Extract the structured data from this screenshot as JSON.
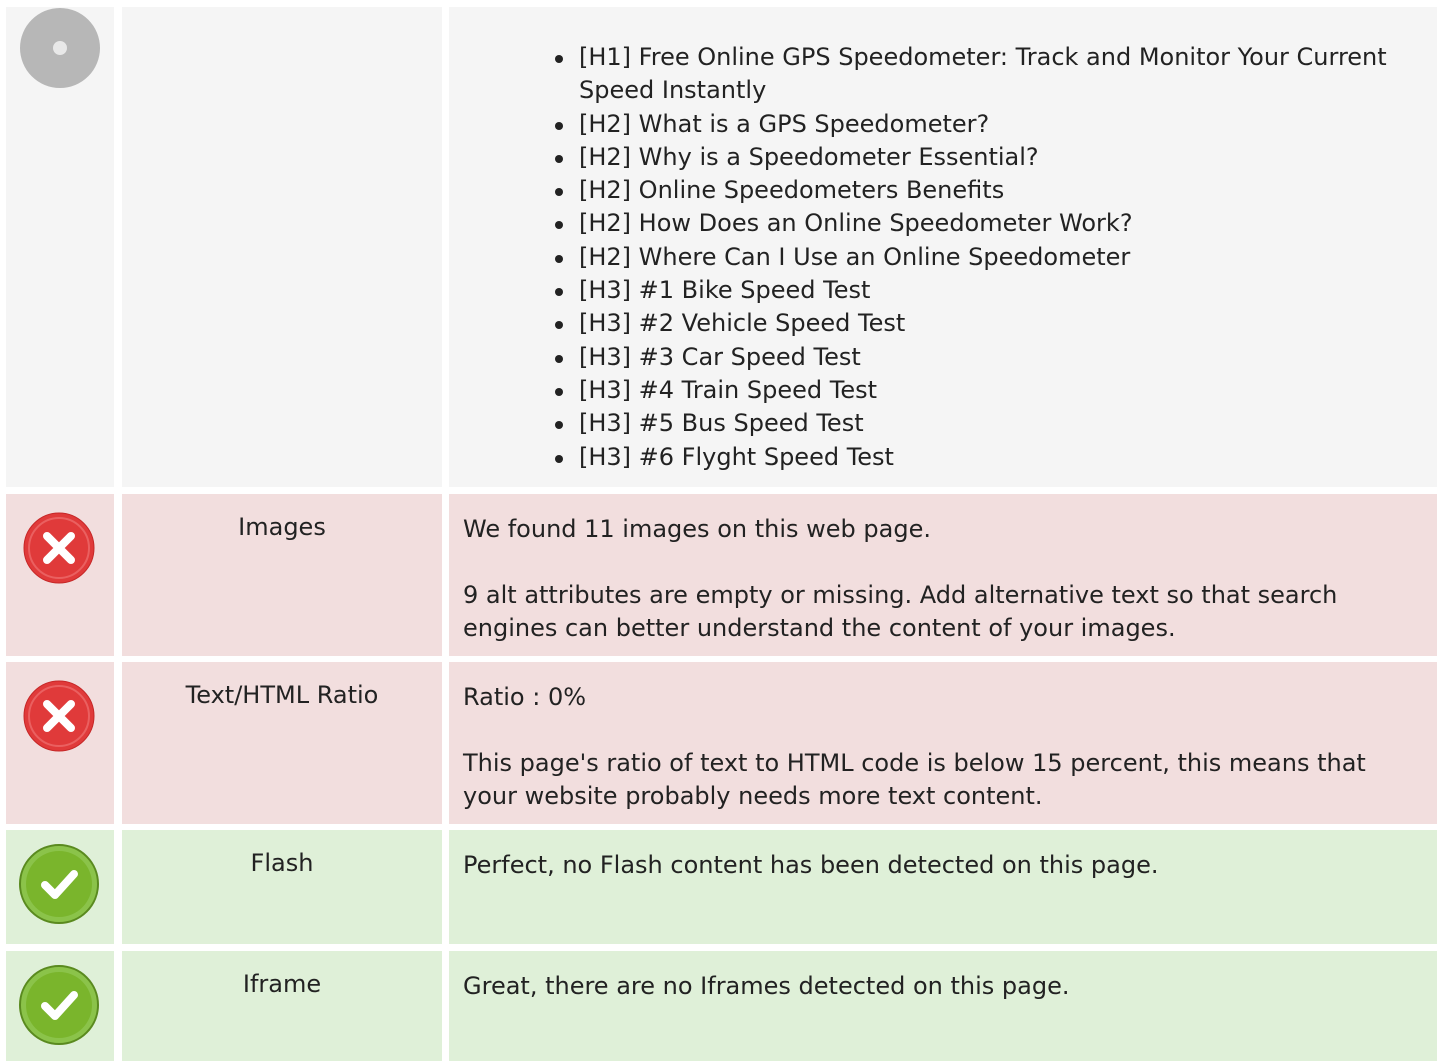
{
  "headings": {
    "items": [
      "[H1] Free Online GPS Speedometer: Track and Monitor Your Current Speed Instantly",
      "[H2] What is a GPS Speedometer?",
      "[H2] Why is a Speedometer Essential?",
      "[H2] Online Speedometers Benefits",
      "[H2] How Does an Online Speedometer Work?",
      "[H2] Where Can I Use an Online Speedometer",
      "[H3] #1 Bike Speed Test",
      "[H3] #2 Vehicle Speed Test",
      "[H3] #3 Car Speed Test",
      "[H3] #4 Train Speed Test",
      "[H3] #5 Bus Speed Test",
      "[H3] #6 Flyght Speed Test"
    ]
  },
  "images": {
    "label": "Images",
    "line1": "We found 11 images on this web page.",
    "line2": "9 alt attributes are empty or missing. Add alternative text so that search engines can better understand the content of your images."
  },
  "ratio": {
    "label": "Text/HTML Ratio",
    "line1": "Ratio : 0%",
    "line2": "This page's ratio of text to HTML code is below 15 percent, this means that your website probably needs more text content."
  },
  "flash": {
    "label": "Flash",
    "line1": "Perfect, no Flash content has been detected on this page."
  },
  "iframe": {
    "label": "Iframe",
    "line1": "Great, there are no Iframes detected on this page."
  },
  "colors": {
    "neutral_bg": "#f5f5f5",
    "error_bg": "#f2dede",
    "success_bg": "#dff0d8",
    "error_icon": "#e03a3a",
    "success_icon": "#7ab52c",
    "neutral_icon": "#b7b7b7"
  }
}
